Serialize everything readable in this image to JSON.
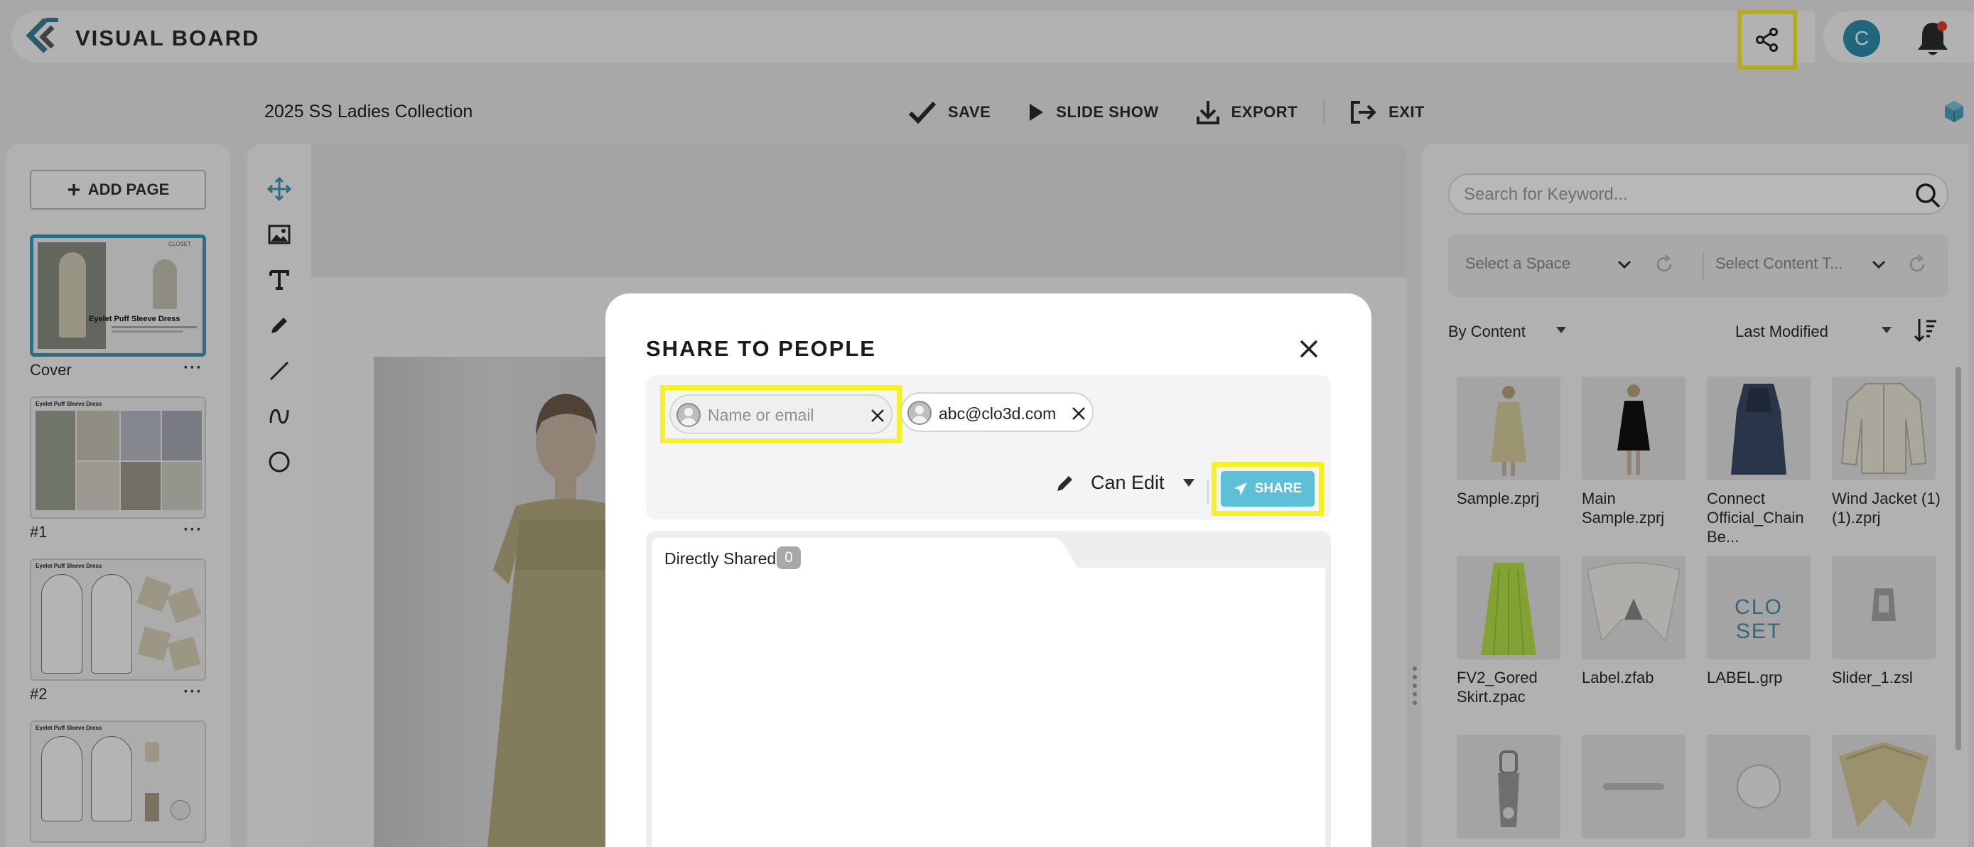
{
  "app": {
    "brand": "VISUAL BOARD"
  },
  "header": {
    "avatar_initial": "C"
  },
  "board": {
    "title": "2025 SS Ladies Collection"
  },
  "toolbar": {
    "save_label": "SAVE",
    "slideshow_label": "SLIDE SHOW",
    "export_label": "EXPORT",
    "exit_label": "EXIT"
  },
  "pages": {
    "add_label": "ADD PAGE",
    "more_glyph": "···",
    "items": [
      {
        "label": "Cover",
        "active": true
      },
      {
        "label": "#1",
        "active": false
      },
      {
        "label": "#2",
        "active": false
      },
      {
        "label": "",
        "active": false
      }
    ]
  },
  "library": {
    "search_placeholder": "Search for Keyword...",
    "space_placeholder": "Select a Space",
    "content_type_placeholder": "Select Content T...",
    "group_by": "By Content",
    "sort_by": "Last Modified",
    "assets": [
      {
        "name": "Sample.zprj"
      },
      {
        "name": "Main Sample.zprj"
      },
      {
        "name": "Connect Official_Chain Be..."
      },
      {
        "name": "Wind Jacket (1) (1).zprj"
      },
      {
        "name": "FV2_Gored Skirt.zpac"
      },
      {
        "name": "Label.zfab"
      },
      {
        "name": "LABEL.grp"
      },
      {
        "name": "Slider_1.zsl"
      },
      {
        "name": ""
      },
      {
        "name": ""
      },
      {
        "name": ""
      },
      {
        "name": ""
      }
    ],
    "logo_text": "CLO SET"
  },
  "modal": {
    "title": "SHARE TO PEOPLE",
    "name_placeholder": "Name or email",
    "invited_email": "abc@clo3d.com",
    "permission": "Can Edit",
    "share_label": "SHARE",
    "tab_label": "Directly Shared",
    "tab_count": "0"
  },
  "thumbnail_text": {
    "cover_title": "Eyelet Puff Sleeve Dress",
    "cover_brand": "CLOSET",
    "page_title": "Eyelet Puff Sleeve Dress"
  },
  "colors": {
    "accent": "#3b9bb5",
    "highlight": "#f4f224",
    "share_button": "#5cc1d7",
    "notification": "#e53b2d"
  }
}
